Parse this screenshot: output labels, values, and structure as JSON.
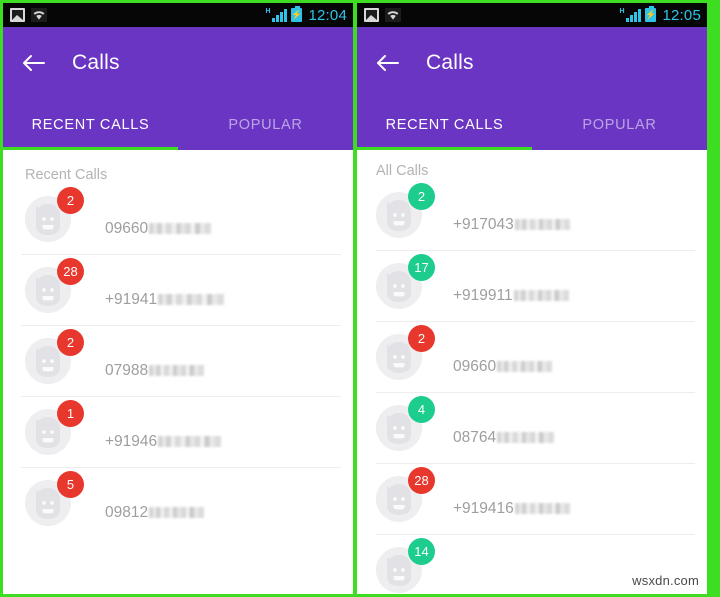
{
  "colors": {
    "appbar_purple": "#6a35c3",
    "divider_green": "#3ddd21",
    "badge_red": "#e8372c",
    "badge_green": "#1ccd8e",
    "status_bar_black": "#060606",
    "status_accent_cyan": "#2fc3e8",
    "list_text_grey": "#9e9e9e",
    "section_title_grey": "#b3b3b3"
  },
  "watermark": "wsxdn.com",
  "panels": [
    {
      "id": "left",
      "status_bar": {
        "time": "12:04",
        "icons": [
          "gallery-icon",
          "wifi-icon",
          "signal-icon",
          "battery-charging-icon"
        ],
        "network_label": "H"
      },
      "appbar": {
        "back_label": "back-arrow-icon",
        "title": "Calls"
      },
      "tabs": [
        {
          "label": "RECENT CALLS",
          "active": true
        },
        {
          "label": "POPULAR",
          "active": false
        }
      ],
      "section_title": "Recent Calls",
      "calls": [
        {
          "badge": "2",
          "badge_color": "red",
          "number": "09660",
          "redacted_width": 62
        },
        {
          "badge": "28",
          "badge_color": "red",
          "number": "+91941",
          "redacted_width": 66
        },
        {
          "badge": "2",
          "badge_color": "red",
          "number": "07988",
          "redacted_width": 55
        },
        {
          "badge": "1",
          "badge_color": "red",
          "number": "+91946",
          "redacted_width": 63
        },
        {
          "badge": "5",
          "badge_color": "red",
          "number": "09812",
          "redacted_width": 55
        }
      ]
    },
    {
      "id": "right",
      "status_bar": {
        "time": "12:05",
        "icons": [
          "gallery-icon",
          "wifi-icon",
          "signal-icon",
          "battery-charging-icon"
        ],
        "network_label": "H"
      },
      "appbar": {
        "back_label": "back-arrow-icon",
        "title": "Calls"
      },
      "tabs": [
        {
          "label": "RECENT CALLS",
          "active": true
        },
        {
          "label": "POPULAR",
          "active": false
        }
      ],
      "section_title": "All Calls",
      "calls": [
        {
          "badge": "2",
          "badge_color": "green",
          "number": "+917043",
          "redacted_width": 55
        },
        {
          "badge": "17",
          "badge_color": "green",
          "number": "+919911",
          "redacted_width": 55
        },
        {
          "badge": "2",
          "badge_color": "red",
          "number": "09660",
          "redacted_width": 55
        },
        {
          "badge": "4",
          "badge_color": "green",
          "number": "08764",
          "redacted_width": 57
        },
        {
          "badge": "28",
          "badge_color": "red",
          "number": "+919416",
          "redacted_width": 55
        },
        {
          "badge": "14",
          "badge_color": "green",
          "number": "",
          "redacted_width": 0
        }
      ]
    }
  ]
}
